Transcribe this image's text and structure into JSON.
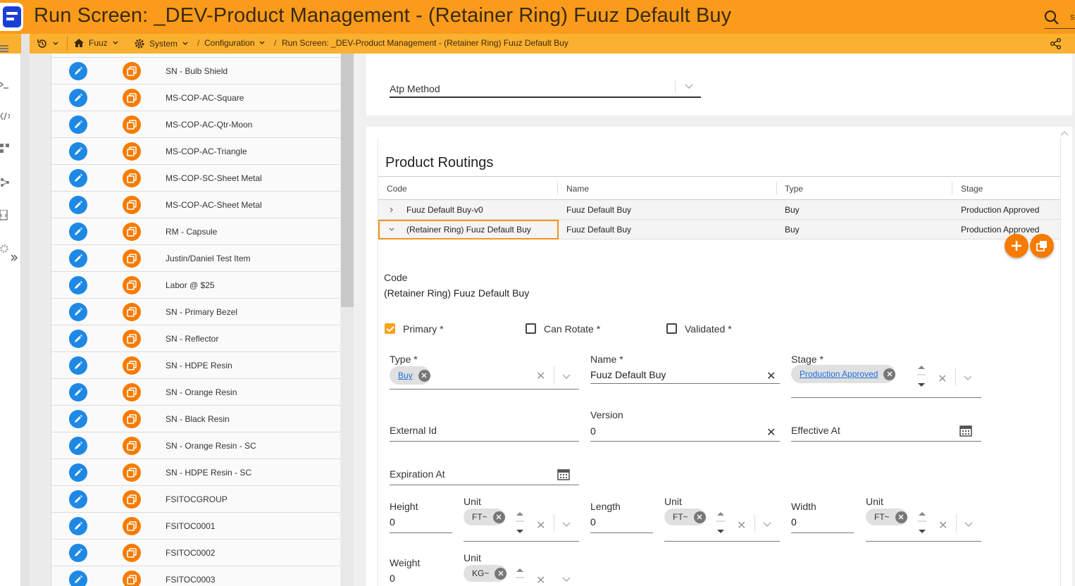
{
  "app": {
    "title": "Run Screen: _DEV-Product Management - (Retainer Ring) Fuuz Default Buy",
    "search_hint": "s"
  },
  "breadcrumb": {
    "tenant": "Fuuz",
    "system": "System",
    "configuration": "Configuration",
    "current": "Run Screen: _DEV-Product Management - (Retainer Ring) Fuuz Default Buy"
  },
  "list": {
    "items": [
      "SN - Bulb Shield",
      "MS-COP-AC-Square",
      "MS-COP-AC-Qtr-Moon",
      "MS-COP-AC-Triangle",
      "MS-COP-SC-Sheet Metal",
      "MS-COP-AC-Sheet Metal",
      "RM - Capsule",
      "Justin/Daniel Test Item",
      "Labor @ $25",
      "SN - Primary Bezel",
      "SN - Reflector",
      "SN - HDPE Resin",
      "SN - Orange Resin",
      "SN - Black Resin",
      "SN - Orange Resin - SC",
      "SN - HDPE Resin - SC",
      "FSITOCGROUP",
      "FSITOC0001",
      "FSITOC0002",
      "FSITOC0003"
    ]
  },
  "atp": {
    "label": "Atp Method"
  },
  "routings": {
    "title": "Product Routings",
    "columns": [
      "Code",
      "Name",
      "Type",
      "Stage"
    ],
    "rows": [
      {
        "code": "Fuuz Default Buy-v0",
        "name": "Fuuz Default Buy",
        "type": "Buy",
        "stage": "Production Approved"
      },
      {
        "code": "(Retainer Ring) Fuuz Default Buy",
        "name": "Fuuz Default Buy",
        "type": "Buy",
        "stage": "Production Approved"
      }
    ]
  },
  "form": {
    "code_label": "Code",
    "code_value": "(Retainer Ring) Fuuz Default Buy",
    "primary_label": "Primary *",
    "can_rotate_label": "Can Rotate *",
    "validated_label": "Validated *",
    "primary_checked": true,
    "type_label": "Type *",
    "type_value": "Buy",
    "name_label": "Name *",
    "name_value": "Fuuz Default Buy",
    "stage_label": "Stage *",
    "stage_value": "Production Approved",
    "external_id_label": "External Id",
    "version_label": "Version",
    "version_value": "0",
    "effective_at_label": "Effective At",
    "expiration_at_label": "Expiration At",
    "height_label": "Height",
    "height_value": "0",
    "length_label": "Length",
    "length_value": "0",
    "width_label": "Width",
    "width_value": "0",
    "unit_label": "Unit",
    "unit_ft": "FT~",
    "weight_label": "Weight",
    "weight_value": "0",
    "unit_kg": "KG~"
  },
  "colors": {
    "header": "#fb9b1b",
    "breadcrumb": "#fbb030",
    "edit": "#1e88e5",
    "copy": "#f57c00",
    "accent": "#f29422"
  },
  "icons": [
    "search-icon",
    "history-icon",
    "home-icon",
    "gear-icon",
    "share-icon",
    "pencil-icon",
    "copy-icon",
    "plus-icon",
    "calendar-icon",
    "chevron-down-icon",
    "chevron-right-icon",
    "close-icon"
  ]
}
